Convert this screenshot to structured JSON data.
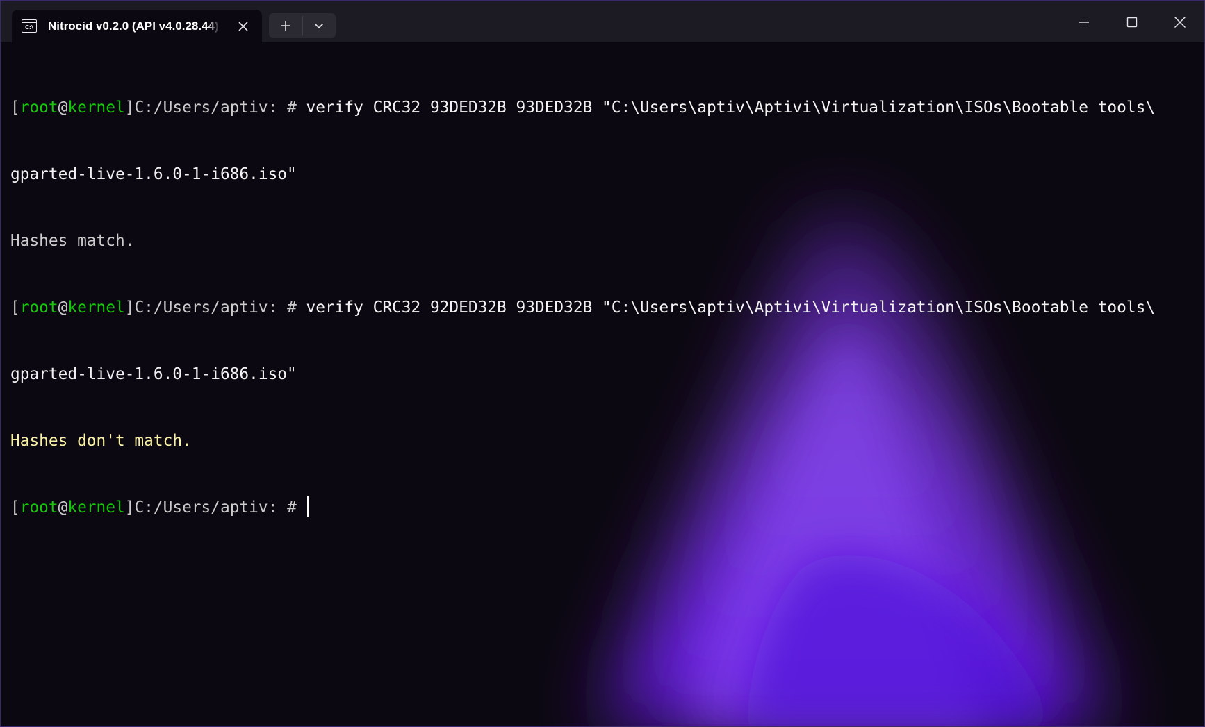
{
  "window": {
    "tab_title": "Nitrocid v0.2.0 (API v4.0.28.44)",
    "tab_icon": "console-icon",
    "new_tab_icon": "plus-icon",
    "dropdown_icon": "chevron-down-icon",
    "minimize_icon": "minimize-icon",
    "maximize_icon": "maximize-icon",
    "close_icon": "close-icon"
  },
  "prompt": {
    "open_bracket": "[",
    "user": "root",
    "at": "@",
    "host": "kernel",
    "close_bracket": "]",
    "path": "C:/Users/aptiv: # "
  },
  "terminal": {
    "cmd1_line1": "verify CRC32 93DED32B 93DED32B \"C:\\Users\\aptiv\\Aptivi\\Virtualization\\ISOs\\Bootable tools\\",
    "cmd1_line2": "gparted-live-1.6.0-1-i686.iso\"",
    "result1": "Hashes match.",
    "cmd2_line1": "verify CRC32 92DED32B 93DED32B \"C:\\Users\\aptiv\\Aptivi\\Virtualization\\ISOs\\Bootable tools\\",
    "cmd2_line2": "gparted-live-1.6.0-1-i686.iso\"",
    "result2": "Hashes don't match."
  },
  "colors": {
    "prompt_user": "#16c60c",
    "warning_text": "#f9f1a5",
    "glow": "#8a3ff0"
  }
}
